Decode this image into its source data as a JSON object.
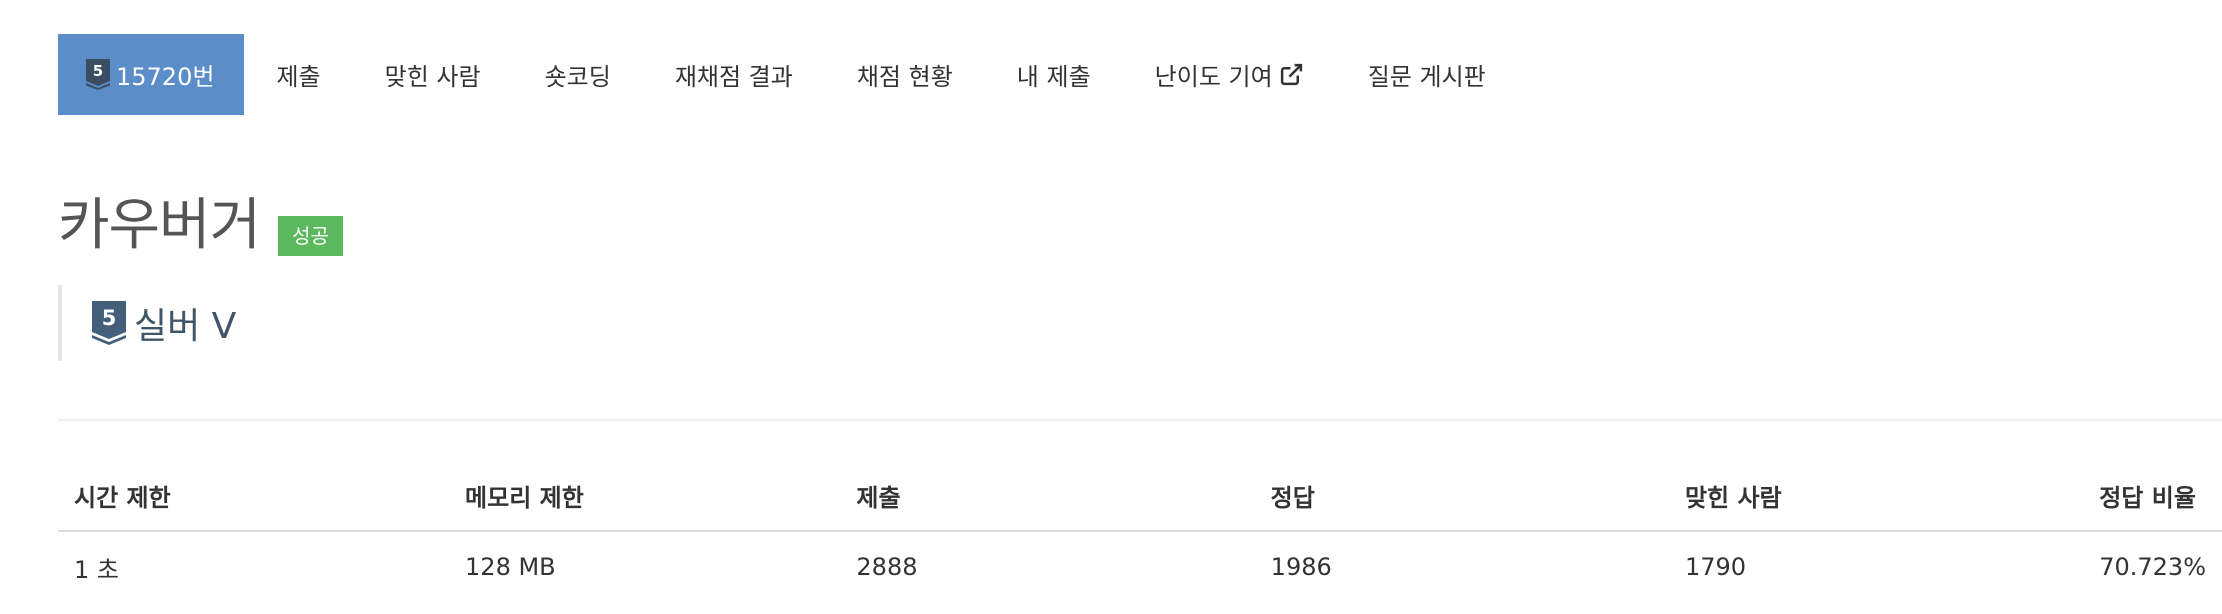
{
  "tabs": [
    {
      "label": "15720번",
      "active": true,
      "tier_number": "5"
    },
    {
      "label": "제출"
    },
    {
      "label": "맞힌 사람"
    },
    {
      "label": "숏코딩"
    },
    {
      "label": "재채점 결과"
    },
    {
      "label": "채점 현황"
    },
    {
      "label": "내 제출"
    },
    {
      "label": "난이도 기여",
      "icon": "external-link-icon"
    },
    {
      "label": "질문 게시판"
    }
  ],
  "problem": {
    "title": "카우버거",
    "result_badge": "성공",
    "tier_number": "5",
    "tier_name": "실버 V"
  },
  "info_table": {
    "headers": [
      "시간 제한",
      "메모리 제한",
      "제출",
      "정답",
      "맞힌 사람",
      "정답 비율"
    ],
    "row": [
      "1 초",
      "128 MB",
      "2888",
      "1986",
      "1790",
      "70.723%"
    ]
  },
  "colors": {
    "active_tab": "#5b8dc9",
    "success_badge": "#5cb85c",
    "tier_silver": "#435f7a"
  },
  "icons": {
    "tier": "tier-shield-icon",
    "external": "external-link-icon"
  }
}
